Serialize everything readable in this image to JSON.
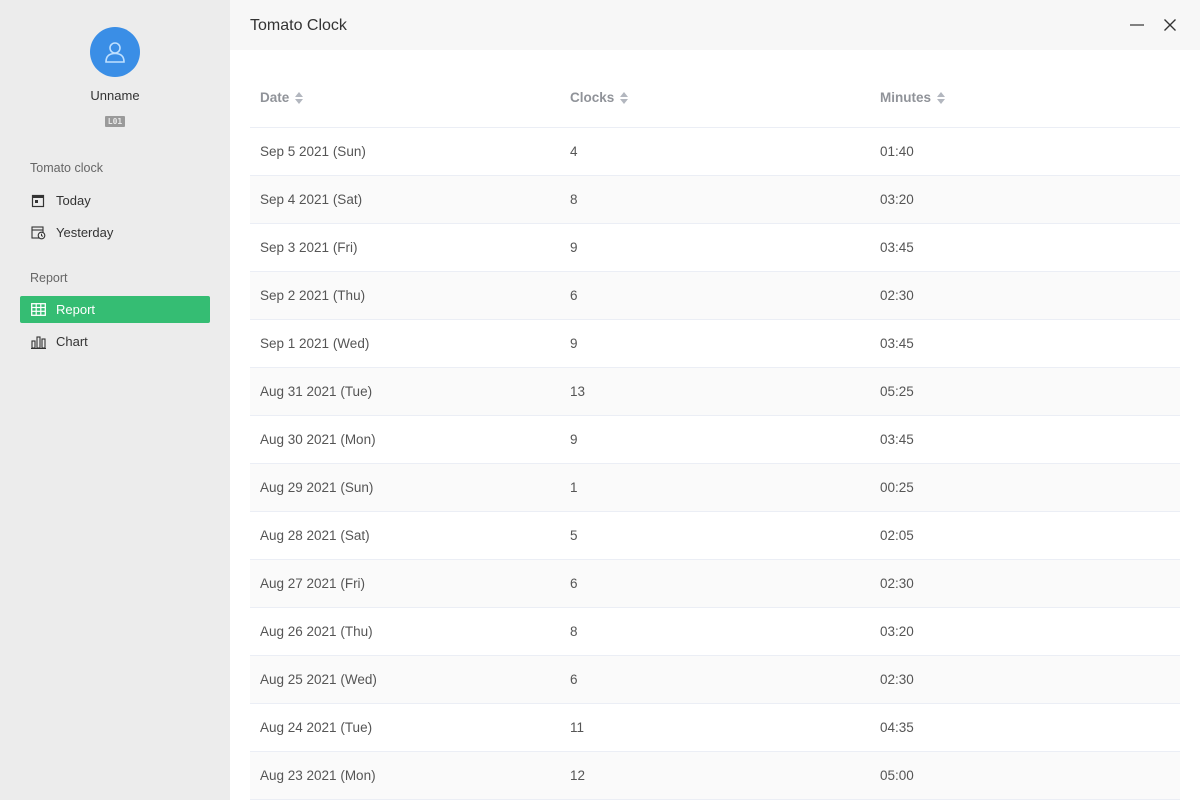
{
  "user": {
    "name": "Unname",
    "level": "L01"
  },
  "sidebar": {
    "sections": [
      {
        "title": "Tomato clock",
        "items": [
          {
            "label": "Today",
            "icon": "calendar-icon"
          },
          {
            "label": "Yesterday",
            "icon": "calendar-history-icon"
          }
        ]
      },
      {
        "title": "Report",
        "items": [
          {
            "label": "Report",
            "icon": "table-icon",
            "active": true
          },
          {
            "label": "Chart",
            "icon": "bar-chart-icon"
          }
        ]
      }
    ]
  },
  "header": {
    "title": "Tomato Clock"
  },
  "table": {
    "columns": [
      "Date",
      "Clocks",
      "Minutes"
    ],
    "rows": [
      [
        "Sep 5 2021 (Sun)",
        "4",
        "01:40"
      ],
      [
        "Sep 4 2021 (Sat)",
        "8",
        "03:20"
      ],
      [
        "Sep 3 2021 (Fri)",
        "9",
        "03:45"
      ],
      [
        "Sep 2 2021 (Thu)",
        "6",
        "02:30"
      ],
      [
        "Sep 1 2021 (Wed)",
        "9",
        "03:45"
      ],
      [
        "Aug 31 2021 (Tue)",
        "13",
        "05:25"
      ],
      [
        "Aug 30 2021 (Mon)",
        "9",
        "03:45"
      ],
      [
        "Aug 29 2021 (Sun)",
        "1",
        "00:25"
      ],
      [
        "Aug 28 2021 (Sat)",
        "5",
        "02:05"
      ],
      [
        "Aug 27 2021 (Fri)",
        "6",
        "02:30"
      ],
      [
        "Aug 26 2021 (Thu)",
        "8",
        "03:20"
      ],
      [
        "Aug 25 2021 (Wed)",
        "6",
        "02:30"
      ],
      [
        "Aug 24 2021 (Tue)",
        "11",
        "04:35"
      ],
      [
        "Aug 23 2021 (Mon)",
        "12",
        "05:00"
      ]
    ]
  },
  "colors": {
    "accent": "#35bd73",
    "avatar": "#3a8ee6",
    "sidebar_bg": "#ececec"
  }
}
